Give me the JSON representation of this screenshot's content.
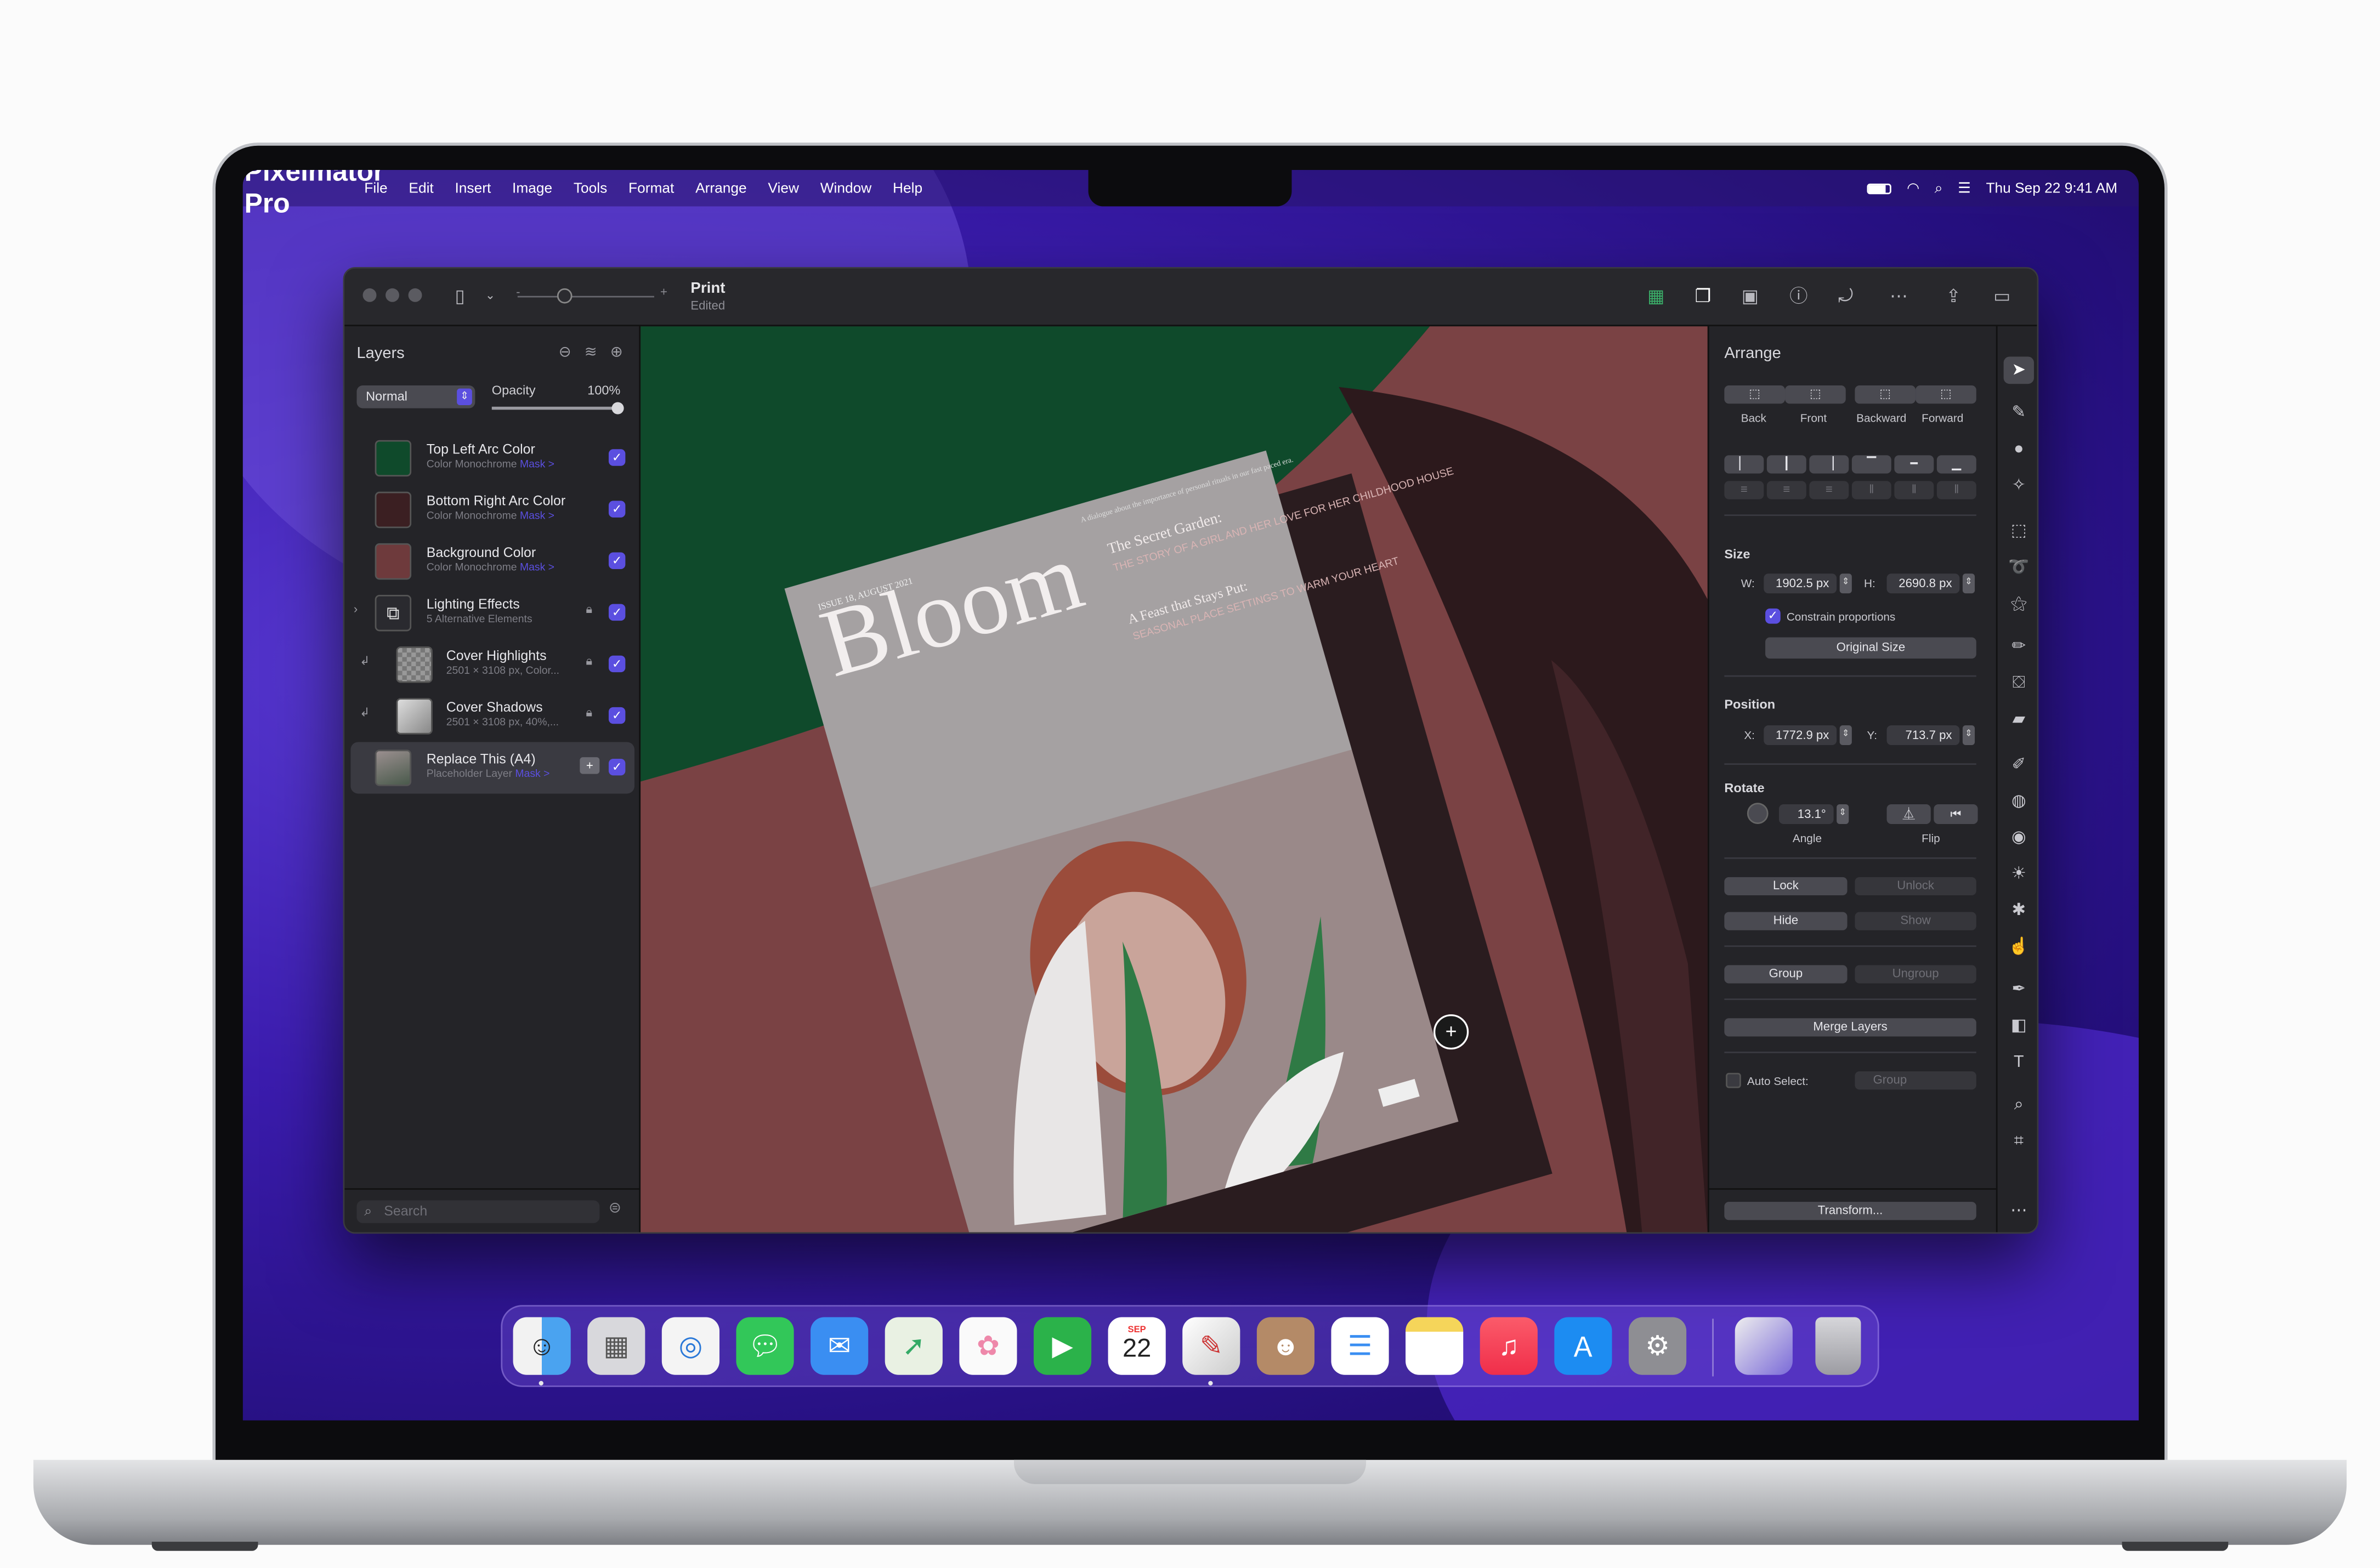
{
  "menubar": {
    "apple": "",
    "app_name": "Pixelmator Pro",
    "menus": [
      "File",
      "Edit",
      "Insert",
      "Image",
      "Tools",
      "Format",
      "Arrange",
      "View",
      "Window",
      "Help"
    ],
    "clock": "Thu Sep 22  9:41 AM"
  },
  "window": {
    "title": "Print",
    "subtitle": "Edited"
  },
  "layers_panel": {
    "title": "Layers",
    "blend_mode": "Normal",
    "opacity_label": "Opacity",
    "opacity_value": "100%",
    "opacity_level": 1.0,
    "layers": [
      {
        "name": "Top Left Arc Color",
        "sub": "Color Monochrome",
        "mask": "Mask >",
        "color": "#0f4a2b"
      },
      {
        "name": "Bottom Right Arc Color",
        "sub": "Color Monochrome",
        "mask": "Mask >",
        "color": "#3b1f22"
      },
      {
        "name": "Background Color",
        "sub": "Color Monochrome",
        "mask": "Mask >",
        "color": "#6e3a3c"
      },
      {
        "name": "Lighting Effects",
        "sub": "5 Alternative Elements"
      },
      {
        "name": "Cover Highlights",
        "sub": "2501 × 3108 px, Color..."
      },
      {
        "name": "Cover Shadows",
        "sub": "2501 × 3108 px, 40%,..."
      },
      {
        "name": "Replace This (A4)",
        "sub": "Placeholder Layer",
        "mask": "Mask >"
      }
    ],
    "search_placeholder": "Search"
  },
  "canvas": {
    "magazine": {
      "title": "Bloom",
      "issue": "ISSUE 18, AUGUST 2021",
      "tagline": "A dialogue about the importance of personal rituals in our fast paced era.",
      "story1_head": "The Secret Garden:",
      "story1_body": "THE STORY OF A GIRL AND HER LOVE FOR HER CHILDHOOD HOUSE",
      "story2_head": "A Feast that Stays Put:",
      "story2_body": "SEASONAL PLACE SETTINGS TO WARM YOUR HEART"
    }
  },
  "arrange_panel": {
    "title": "Arrange",
    "order_buttons": [
      "Back",
      "Front",
      "Backward",
      "Forward"
    ],
    "size_label": "Size",
    "w_label": "W:",
    "w_value": "1902.5 px",
    "h_label": "H:",
    "h_value": "2690.8 px",
    "constrain": "Constrain proportions",
    "original_size": "Original Size",
    "position_label": "Position",
    "x_label": "X:",
    "x_value": "1772.9 px",
    "y_label": "Y:",
    "y_value": "713.7 px",
    "rotate_label": "Rotate",
    "angle_value": "13.1°",
    "angle_label": "Angle",
    "flip_label": "Flip",
    "lock": "Lock",
    "unlock": "Unlock",
    "hide": "Hide",
    "show": "Show",
    "group": "Group",
    "ungroup": "Ungroup",
    "merge": "Merge Layers",
    "auto_select": "Auto Select:",
    "auto_select_value": "Group",
    "transform": "Transform..."
  },
  "dock": {
    "calendar_month": "SEP",
    "calendar_day": "22",
    "apps": [
      "finder-icon",
      "launchpad-icon",
      "safari-icon",
      "messages-icon",
      "mail-icon",
      "maps-icon",
      "photos-icon",
      "facetime-icon",
      "calendar-icon",
      "pixelmator-icon",
      "contacts-icon",
      "reminders-icon",
      "notes-icon",
      "music-icon",
      "app-store-icon",
      "system-preferences-icon",
      "downloads-stack-icon",
      "trash-icon"
    ]
  },
  "colors": {
    "accent": "#5b4fe0",
    "wallpaper": "#3b1cae",
    "canvas_green": "#0f4a2b",
    "canvas_rose": "#7a4244"
  }
}
